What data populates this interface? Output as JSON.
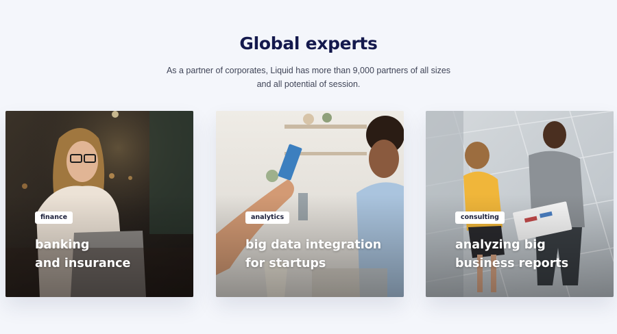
{
  "header": {
    "title": "Global experts",
    "subtitle": "As a partner of corporates, Liquid has more than 9,000 partners of all sizes and all potential of session."
  },
  "cards": [
    {
      "tag": "finance",
      "title": "banking\nand insurance"
    },
    {
      "tag": "analytics",
      "title": "big data integration\nfor startups"
    },
    {
      "tag": "consulting",
      "title": "analyzing big\nbusiness reports"
    }
  ]
}
